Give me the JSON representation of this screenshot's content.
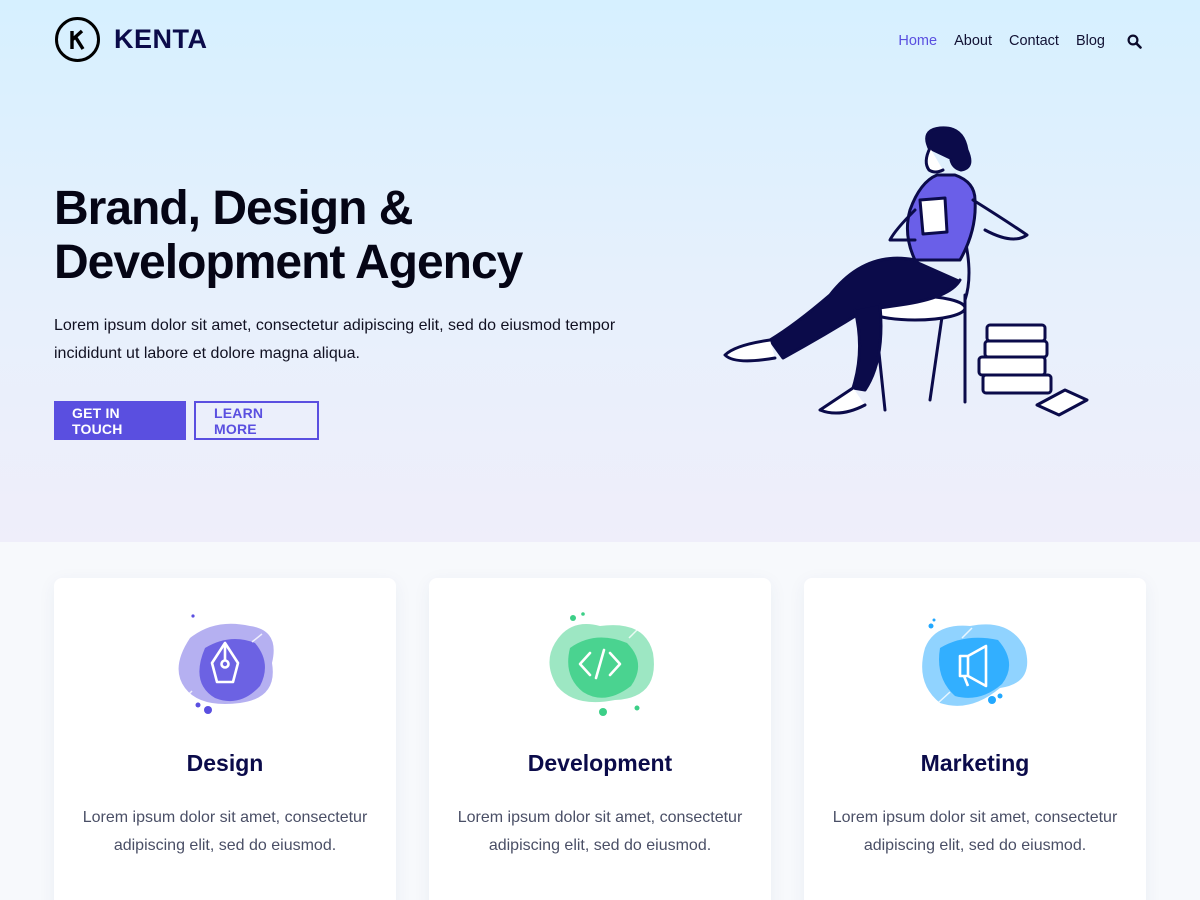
{
  "header": {
    "brand": "KENTA",
    "nav": [
      {
        "label": "Home",
        "active": true
      },
      {
        "label": "About",
        "active": false
      },
      {
        "label": "Contact",
        "active": false
      },
      {
        "label": "Blog",
        "active": false
      }
    ],
    "search_icon": "search-icon"
  },
  "hero": {
    "headline_line1": "Brand, Design &",
    "headline_line2": "Development Agency",
    "lede": "Lorem ipsum dolor sit amet, consectetur adipiscing elit, sed do eiusmod tempor incididunt ut labore et dolore magna aliqua.",
    "primary_button": "GET IN TOUCH",
    "secondary_button": "LEARN MORE"
  },
  "services": [
    {
      "title": "Design",
      "text": "Lorem ipsum dolor sit amet, consectetur adipiscing elit, sed do eiusmod.",
      "icon": "pen-nib-icon",
      "color": "#5a4fe0"
    },
    {
      "title": "Development",
      "text": "Lorem ipsum dolor sit amet, consectetur adipiscing elit, sed do eiusmod.",
      "icon": "code-icon",
      "color": "#3ccf87"
    },
    {
      "title": "Marketing",
      "text": "Lorem ipsum dolor sit amet, consectetur adipiscing elit, sed do eiusmod.",
      "icon": "megaphone-icon",
      "color": "#22a8ff"
    }
  ],
  "colors": {
    "accent": "#5a4fe0",
    "navy": "#0b0b4a"
  }
}
